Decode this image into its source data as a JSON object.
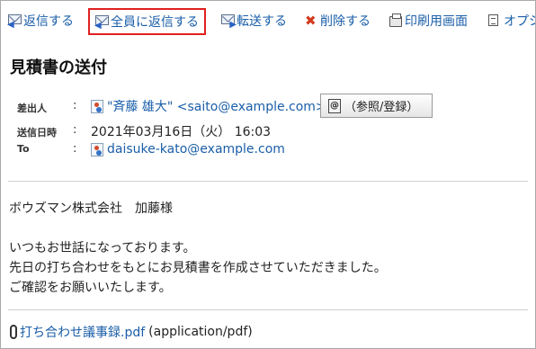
{
  "toolbar": {
    "reply": "返信する",
    "reply_all": "全員に返信する",
    "forward": "転送する",
    "delete": "削除する",
    "print": "印刷用画面",
    "options": "オプシ"
  },
  "message": {
    "subject": "見積書の送付",
    "from_label": "差出人",
    "from_value": "\"斉藤 雄大\" <saito@example.com>",
    "ref_button": "（参照/登録）",
    "sent_label": "送信日時",
    "sent_value": "2021年03月16日（火） 16:03",
    "to_label": "To",
    "to_value": "daisuke-kato@example.com",
    "colon": ":",
    "body": [
      "ボウズマン株式会社　加藤様",
      "いつもお世話になっております。",
      "先日の打ち合わせをもとにお見積書を作成させていただきました。",
      "ご確認をお願いいたします。"
    ],
    "attachment_name": "打ち合わせ議事録.pdf",
    "attachment_type": "(application/pdf)"
  },
  "colors": {
    "link": "#1a5ea8",
    "highlight": "#e02020",
    "delete_icon": "#d23a1c"
  },
  "icons": {
    "reply": "reply-envelope-icon",
    "reply_all": "reply-all-envelope-icon",
    "forward": "forward-envelope-icon",
    "delete": "x-mark-icon",
    "print": "printer-icon",
    "options": "document-icon",
    "person": "user-icon",
    "address_book": "at-sign-icon",
    "attachment": "paperclip-icon"
  }
}
